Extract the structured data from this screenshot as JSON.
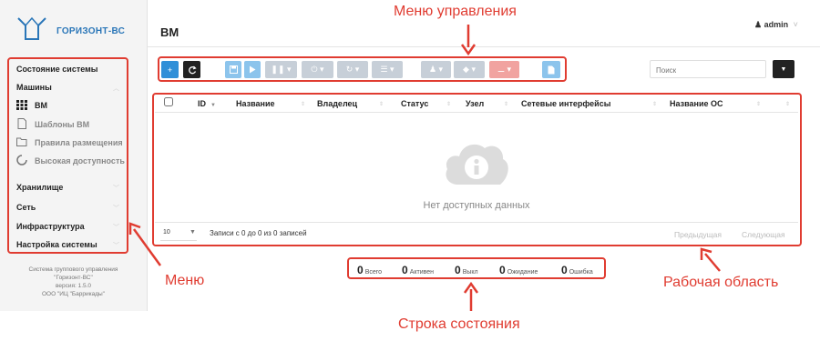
{
  "app": {
    "logo_text": "ГОРИЗОНТ-ВС",
    "page_title": "ВМ",
    "user": "admin"
  },
  "sidebar": {
    "items": [
      {
        "label": "Состояние системы"
      },
      {
        "label": "Машины"
      },
      {
        "label": "ВМ",
        "icon": "grid-icon"
      },
      {
        "label": "Шаблоны ВМ",
        "icon": "file-icon"
      },
      {
        "label": "Правила размещения",
        "icon": "folder-icon"
      },
      {
        "label": "Высокая доступность",
        "icon": "circle-icon"
      },
      {
        "label": "Хранилище"
      },
      {
        "label": "Сеть"
      },
      {
        "label": "Инфраструктура"
      },
      {
        "label": "Настройка системы"
      }
    ],
    "footer": [
      "Система группового управления",
      "\"Горизонт-ВС\"",
      "версия: 1.5.0",
      "ООО \"ИЦ \"Баррикады\""
    ]
  },
  "toolbar": {
    "add": "+",
    "refresh_icon": "refresh-icon",
    "search_placeholder": "Поиск"
  },
  "table": {
    "columns": [
      "ID",
      "Название",
      "Владелец",
      "Статус",
      "Узел",
      "Сетевые интерфейсы",
      "Название ОС"
    ],
    "empty": "Нет доступных данных",
    "page_length": "10",
    "info": "Записи с 0 до 0 из 0 записей",
    "prev": "Предыдущая",
    "next": "Следующая"
  },
  "status": [
    {
      "count": "0",
      "label": "Всего"
    },
    {
      "count": "0",
      "label": "Активен"
    },
    {
      "count": "0",
      "label": "Выкл"
    },
    {
      "count": "0",
      "label": "Ожидание"
    },
    {
      "count": "0",
      "label": "Ошибка"
    }
  ],
  "annotations": {
    "control_menu": "Меню управления",
    "menu": "Меню",
    "workspace": "Рабочая область",
    "status_line": "Строка состояния"
  },
  "colors": {
    "primary": "#2f8fd8",
    "annotation": "#e03c31",
    "dark": "#222222"
  }
}
